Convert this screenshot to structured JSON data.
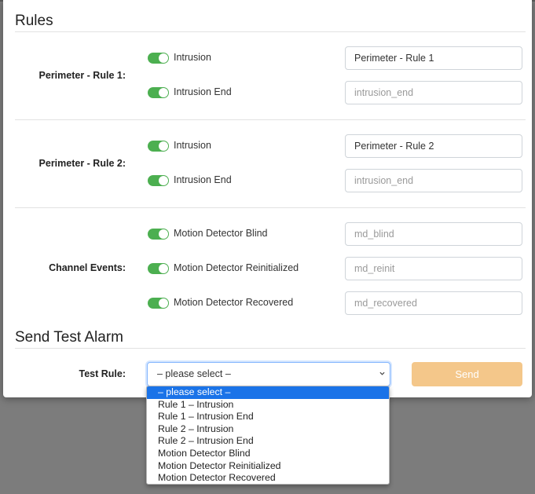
{
  "rules": {
    "title": "Rules",
    "groups": [
      {
        "label": "Perimeter - Rule 1:",
        "items": [
          {
            "toggle_label": "Intrusion",
            "enabled": true,
            "value": "Perimeter - Rule 1",
            "placeholder": ""
          },
          {
            "toggle_label": "Intrusion End",
            "enabled": true,
            "value": "",
            "placeholder": "intrusion_end"
          }
        ]
      },
      {
        "label": "Perimeter - Rule 2:",
        "items": [
          {
            "toggle_label": "Intrusion",
            "enabled": true,
            "value": "Perimeter - Rule 2",
            "placeholder": ""
          },
          {
            "toggle_label": "Intrusion End",
            "enabled": true,
            "value": "",
            "placeholder": "intrusion_end"
          }
        ]
      },
      {
        "label": "Channel Events:",
        "items": [
          {
            "toggle_label": "Motion Detector Blind",
            "enabled": true,
            "value": "",
            "placeholder": "md_blind"
          },
          {
            "toggle_label": "Motion Detector Reinitialized",
            "enabled": true,
            "value": "",
            "placeholder": "md_reinit"
          },
          {
            "toggle_label": "Motion Detector Recovered",
            "enabled": true,
            "value": "",
            "placeholder": "md_recovered"
          }
        ]
      }
    ]
  },
  "test_alarm": {
    "title": "Send Test Alarm",
    "rule_label": "Test Rule:",
    "selected": "– please select –",
    "send_label": "Send",
    "options": [
      "– please select –",
      "Rule 1 – Intrusion",
      "Rule 1 – Intrusion End",
      "Rule 2 – Intrusion",
      "Rule 2 – Intrusion End",
      "Motion Detector Blind",
      "Motion Detector Reinitialized",
      "Motion Detector Recovered"
    ]
  },
  "colors": {
    "toggle_on": "#4caf50",
    "send_button": "#f4c78a",
    "selected_option": "#1a73e8",
    "backdrop": "#7c7c7c"
  }
}
